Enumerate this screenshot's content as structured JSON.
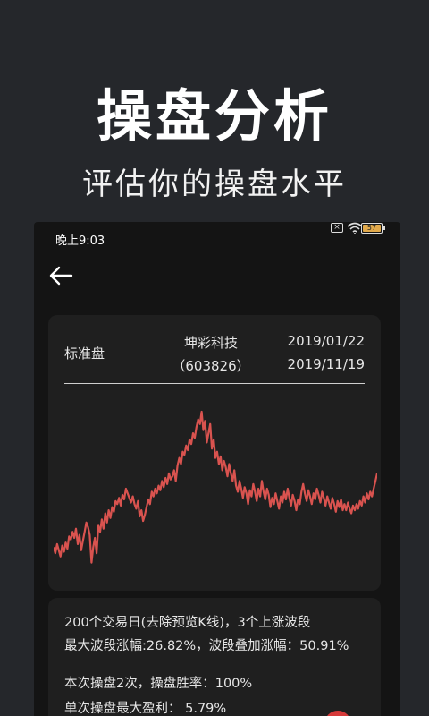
{
  "promo": {
    "title": "操盘分析",
    "subtitle": "评估你的操盘水平"
  },
  "statusbar": {
    "time": "晚上9:03",
    "battery": "57",
    "notification_icon": "x-box-icon",
    "wifi_icon": "wifi-icon"
  },
  "nav": {
    "back_icon": "arrow-left-icon"
  },
  "card": {
    "label": "标准盘",
    "stock_name": "坤彩科技",
    "stock_code": "（603826）",
    "start_date": "2019/01/22",
    "end_date": "2019/11/19"
  },
  "chart_data": {
    "type": "line",
    "title": "",
    "xlabel": "",
    "ylabel": "",
    "grid": false,
    "color": "#d9534f",
    "values": [
      0.12,
      0.08,
      0.14,
      0.1,
      0.06,
      0.13,
      0.09,
      0.15,
      0.11,
      0.19,
      0.17,
      0.22,
      0.18,
      0.24,
      0.14,
      0.2,
      0.1,
      0.16,
      0.22,
      0.28,
      0.25,
      0.2,
      0.02,
      0.12,
      0.18,
      0.08,
      0.26,
      0.22,
      0.3,
      0.24,
      0.34,
      0.28,
      0.36,
      0.31,
      0.38,
      0.35,
      0.42,
      0.4,
      0.44,
      0.39,
      0.46,
      0.43,
      0.5,
      0.47,
      0.44,
      0.41,
      0.45,
      0.4,
      0.37,
      0.42,
      0.32,
      0.36,
      0.29,
      0.33,
      0.38,
      0.43,
      0.4,
      0.48,
      0.45,
      0.5,
      0.47,
      0.52,
      0.49,
      0.55,
      0.51,
      0.57,
      0.53,
      0.6,
      0.56,
      0.58,
      0.62,
      0.55,
      0.65,
      0.7,
      0.66,
      0.74,
      0.72,
      0.78,
      0.75,
      0.82,
      0.79,
      0.86,
      0.83,
      0.9,
      0.95,
      0.92,
      1.0,
      0.88,
      0.94,
      0.8,
      0.86,
      0.92,
      0.76,
      0.82,
      0.7,
      0.74,
      0.66,
      0.71,
      0.62,
      0.68,
      0.64,
      0.58,
      0.66,
      0.6,
      0.55,
      0.62,
      0.52,
      0.48,
      0.55,
      0.5,
      0.44,
      0.51,
      0.47,
      0.4,
      0.49,
      0.45,
      0.53,
      0.48,
      0.42,
      0.5,
      0.45,
      0.55,
      0.48,
      0.43,
      0.5,
      0.46,
      0.38,
      0.44,
      0.4,
      0.47,
      0.42,
      0.37,
      0.45,
      0.41,
      0.48,
      0.43,
      0.5,
      0.44,
      0.39,
      0.46,
      0.42,
      0.36,
      0.43,
      0.4,
      0.48,
      0.53,
      0.47,
      0.42,
      0.49,
      0.45,
      0.4,
      0.47,
      0.43,
      0.5,
      0.46,
      0.41,
      0.48,
      0.44,
      0.39,
      0.45,
      0.41,
      0.37,
      0.44,
      0.4,
      0.35,
      0.42,
      0.38,
      0.43,
      0.36,
      0.4,
      0.36,
      0.41,
      0.37,
      0.34,
      0.39,
      0.36,
      0.4,
      0.37,
      0.42,
      0.39,
      0.45,
      0.41,
      0.47,
      0.43,
      0.48,
      0.45,
      0.5,
      0.55,
      0.6
    ]
  },
  "stats": {
    "line1": "200个交易日(去除预览K线)，3个上涨波段",
    "line2": "最大波段涨幅:26.82%，波段叠加涨幅：50.91%",
    "line3": "本次操盘2次，操盘胜率：100%",
    "line4": "单次操盘最大盈利：   5.79%"
  },
  "colors": {
    "background": "#25272b",
    "card": "#1f1f1f",
    "line": "#d9534f",
    "accent_red": "#d63a3a"
  }
}
